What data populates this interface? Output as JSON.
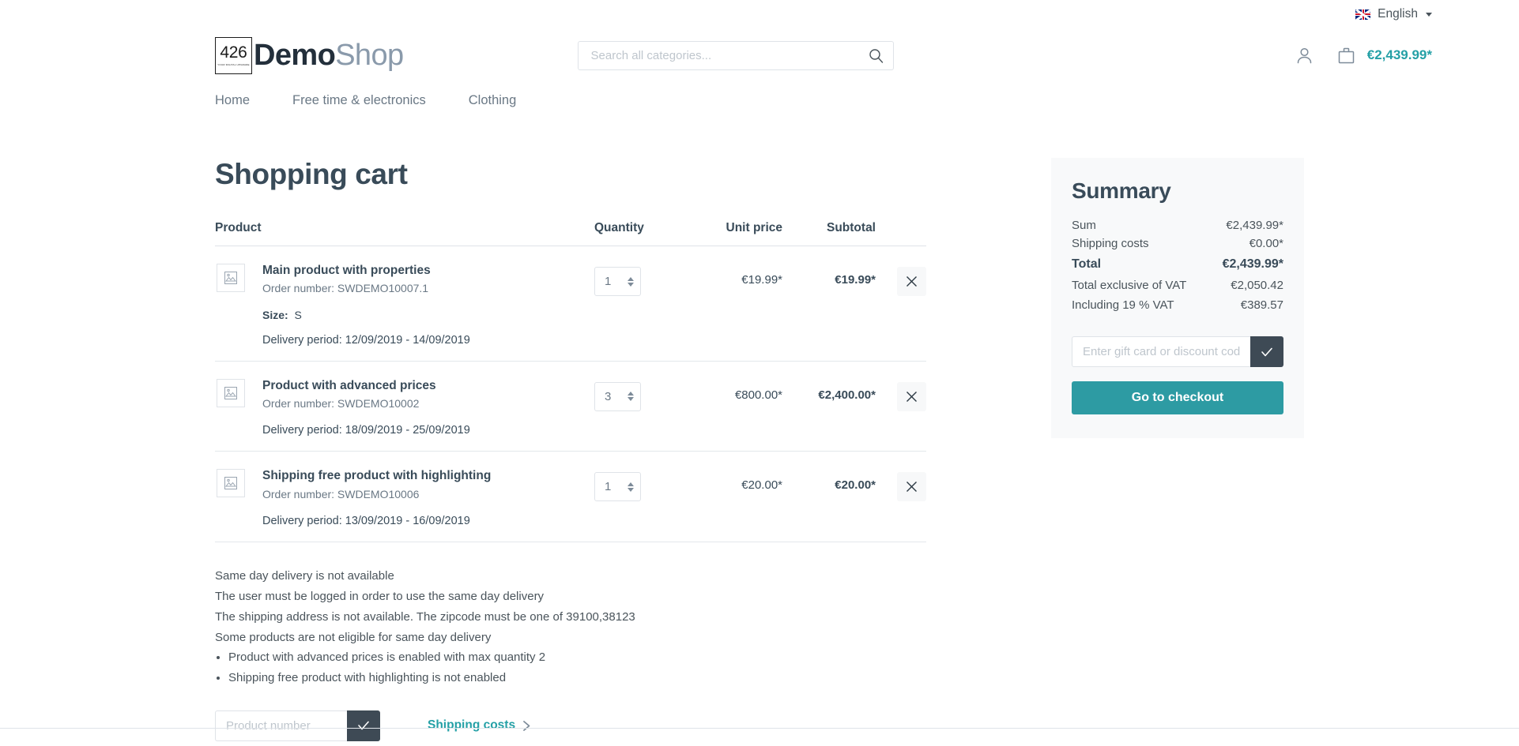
{
  "topbar": {
    "language": "English",
    "flag_icon": "uk-flag-icon",
    "caret_icon": "chevron-down-icon"
  },
  "header": {
    "logo": {
      "badge_number": "426",
      "badge_tagline": "YOUR DIGITAL UPGRADE",
      "name_bold": "Demo",
      "name_light": "Shop"
    },
    "search": {
      "placeholder": "Search all categories...",
      "value": "",
      "icon": "search-icon"
    },
    "account_icon": "user-account-icon",
    "cart_icon": "shopping-bag-icon",
    "cart_total": "€2,439.99*"
  },
  "nav": {
    "items": [
      "Home",
      "Free time & electronics",
      "Clothing"
    ]
  },
  "main": {
    "page_title": "Shopping cart",
    "table_headers": {
      "product": "Product",
      "quantity": "Quantity",
      "unit_price": "Unit price",
      "subtotal": "Subtotal"
    },
    "remove_icon": "close-x-icon",
    "thumbnail_icon": "image-placeholder-icon",
    "rows": [
      {
        "name": "Main product with properties",
        "order_number": "Order number: SWDEMO10007.1",
        "property_label": "Size:",
        "property_value": "S",
        "delivery": "Delivery period: 12/09/2019 - 14/09/2019",
        "quantity": "1",
        "unit_price": "€19.99*",
        "subtotal": "€19.99*"
      },
      {
        "name": "Product with advanced prices",
        "order_number": "Order number: SWDEMO10002",
        "property_label": "",
        "property_value": "",
        "delivery": "Delivery period: 18/09/2019 - 25/09/2019",
        "quantity": "3",
        "unit_price": "€800.00*",
        "subtotal": "€2,400.00*"
      },
      {
        "name": "Shipping free product with highlighting",
        "order_number": "Order number: SWDEMO10006",
        "property_label": "",
        "property_value": "",
        "delivery": "Delivery period: 13/09/2019 - 16/09/2019",
        "quantity": "1",
        "unit_price": "€20.00*",
        "subtotal": "€20.00*"
      }
    ],
    "notices": [
      "Same day delivery is not available",
      "The user must be logged in order to use the same day delivery",
      "The shipping address is not available. The zipcode must be one of 39100,38123",
      "Some products are not eligible for same day delivery"
    ],
    "notice_bullets": [
      "Product with advanced prices is enabled with max quantity 2",
      "Shipping free product with highlighting is not enabled"
    ],
    "product_number_form": {
      "placeholder": "Product number",
      "value": "",
      "submit_icon": "check-icon"
    },
    "shipping_costs_link": {
      "label": "Shipping costs",
      "icon": "chevron-right-icon"
    }
  },
  "summary": {
    "title": "Summary",
    "rows": [
      {
        "label": "Sum",
        "value": "€2,439.99*",
        "bold": false,
        "wrap": false
      },
      {
        "label": "Shipping costs",
        "value": "€0.00*",
        "bold": false,
        "wrap": false
      },
      {
        "label": "Total",
        "value": "€2,439.99*",
        "bold": true,
        "wrap": false
      },
      {
        "label": "Total exclusive of VAT",
        "value": "€2,050.42",
        "bold": false,
        "wrap": true
      },
      {
        "label": "Including 19 % VAT",
        "value": "€389.57",
        "bold": false,
        "wrap": false
      }
    ],
    "gift_form": {
      "placeholder": "Enter gift card or discount code...",
      "value": "",
      "submit_icon": "check-icon"
    },
    "checkout_label": "Go to checkout"
  },
  "colors": {
    "accent_teal": "#24a0a6",
    "checkout_teal": "#2d9ba3",
    "dark": "#394b59",
    "panel_bg": "#f8f9fa"
  }
}
